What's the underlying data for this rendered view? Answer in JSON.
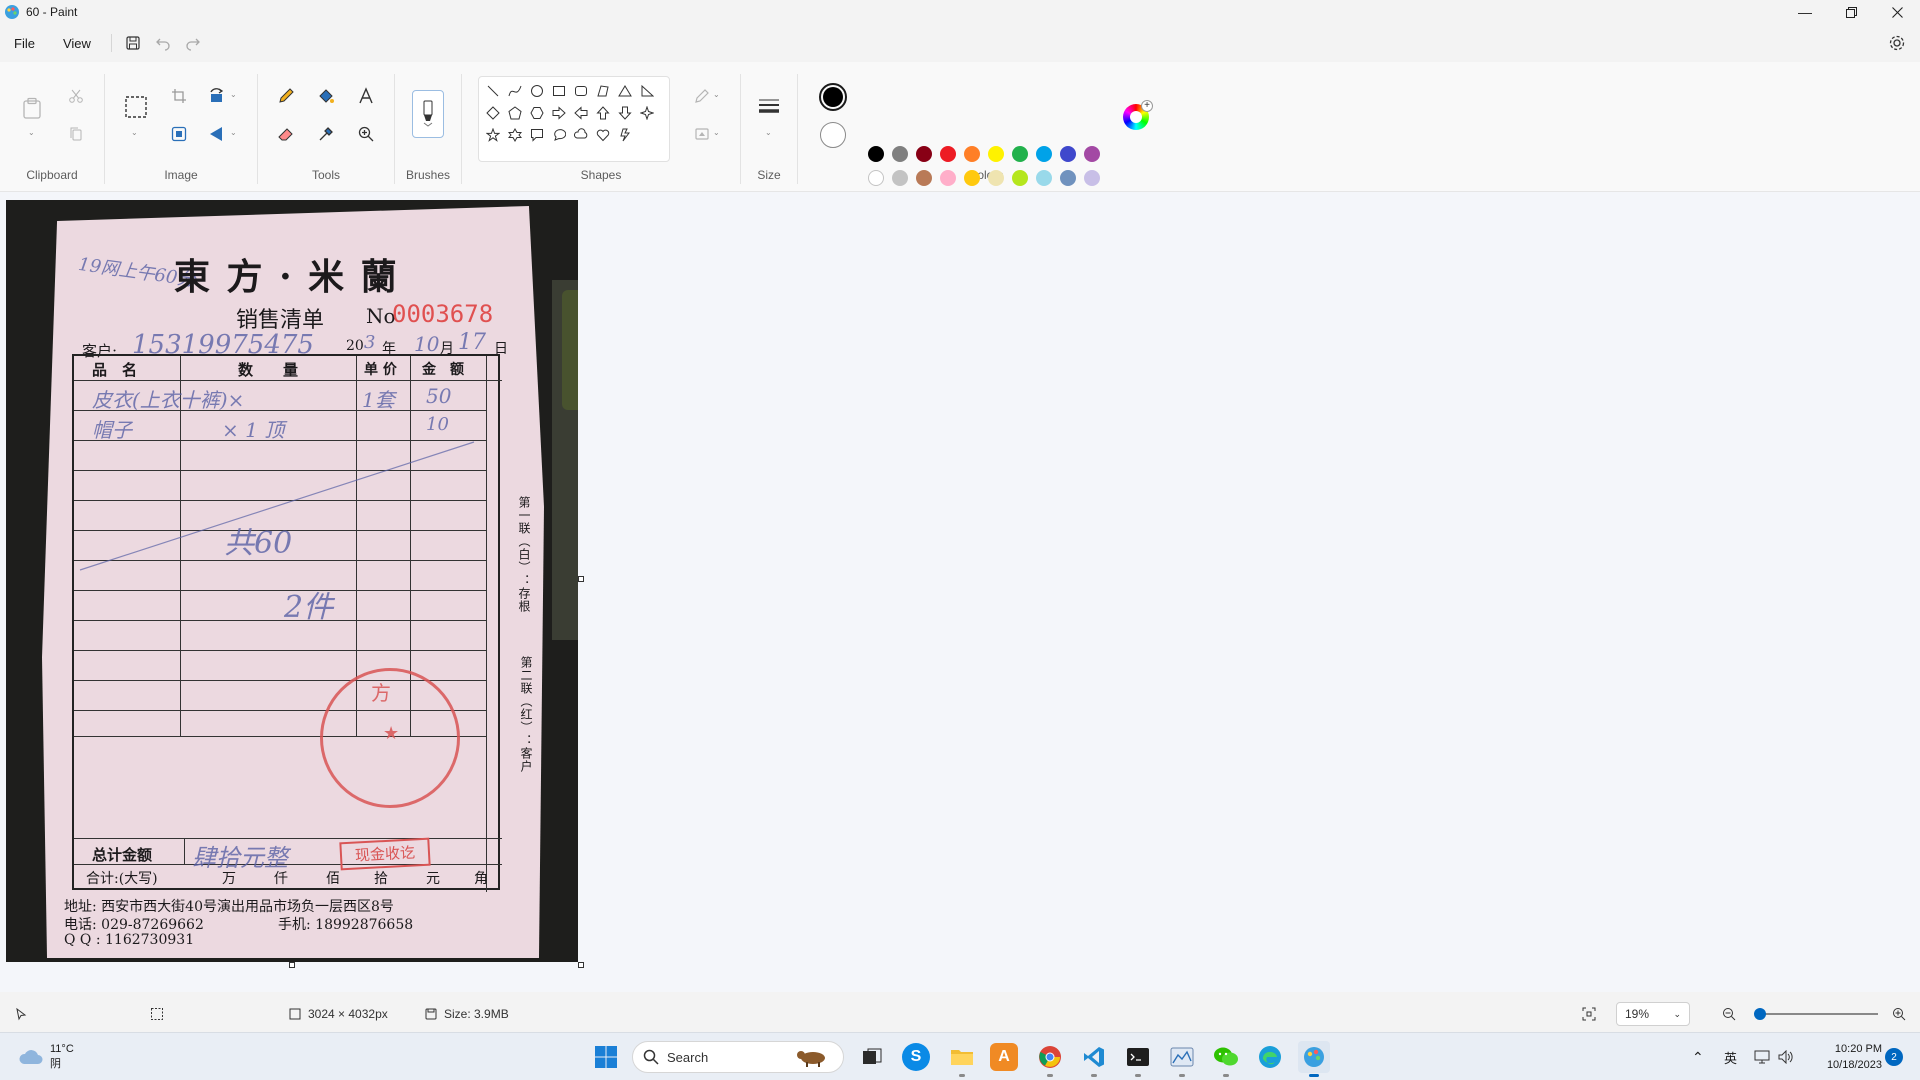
{
  "window": {
    "title": "60 - Paint"
  },
  "menu": {
    "file": "File",
    "view": "View"
  },
  "ribbon": {
    "groups": {
      "clipboard": "Clipboard",
      "image": "Image",
      "tools": "Tools",
      "brushes": "Brushes",
      "shapes": "Shapes",
      "size": "Size",
      "colors": "Colors"
    },
    "palette_row1": [
      "#000000",
      "#7f7f7f",
      "#880015",
      "#ed1c24",
      "#ff7f27",
      "#fff200",
      "#22b14c",
      "#00a2e8",
      "#3f48cc",
      "#a349a4"
    ],
    "palette_row2": [
      "#ffffff",
      "#c3c3c3",
      "#b97a57",
      "#ffaec9",
      "#ffc90e",
      "#efe4b0",
      "#b5e61d",
      "#99d9ea",
      "#7092be",
      "#c8bfe7"
    ],
    "primary_color": "#000000",
    "secondary_color": "#ffffff"
  },
  "receipt": {
    "brand": "東 方 · 米 蘭",
    "subtitle": "销售清单",
    "no_label": "No",
    "no_value": "0003678",
    "customer_label": "客户:",
    "customer_hw": "15319975475",
    "date_hw": "19网上午60分",
    "date_year": "20",
    "date_year_hw": "3",
    "date_nian": "年",
    "date_month_hw": "10",
    "date_yue": "月",
    "date_day_hw": "17",
    "date_ri": "日",
    "headers": [
      "品　名",
      "数　　量",
      "单 价",
      "金　额"
    ],
    "row1_hw": "皮衣(上衣十裤)×",
    "row1_price_hw": "1套",
    "row1_amount_hw": "50",
    "row2_hw": "帽子",
    "row2_qty_hw": "× 1 顶",
    "row2_amount_hw": "10",
    "total_hw": "共60",
    "count_hw": "2件",
    "side_note_1": "第一联（白）：存根",
    "side_note_2": "第二联（红）：客户",
    "total_label": "总计金额",
    "total_amount_hw": "肆拾元整",
    "paid_stamp": "现金收讫",
    "daxie_label": "合计:(大写)",
    "daxie_units": [
      "万",
      "仟",
      "佰",
      "拾",
      "元",
      "角"
    ],
    "address": "地址: 西安市西大街40号演出用品市场负一层西区8号",
    "phone": "电话: 029-87269662",
    "mobile": "手机: 18992876658",
    "qq": "Q Q : 1162730931",
    "stamp_text": "方"
  },
  "status": {
    "dimensions": "3024 × 4032px",
    "size": "Size: 3.9MB",
    "zoom": "19%",
    "zoom_level_percent": 19
  },
  "taskbar": {
    "weather_temp": "11°C",
    "weather_desc": "阴",
    "search": "Search",
    "ime": "英",
    "time": "10:20 PM",
    "date": "10/18/2023",
    "notifications": "2"
  }
}
